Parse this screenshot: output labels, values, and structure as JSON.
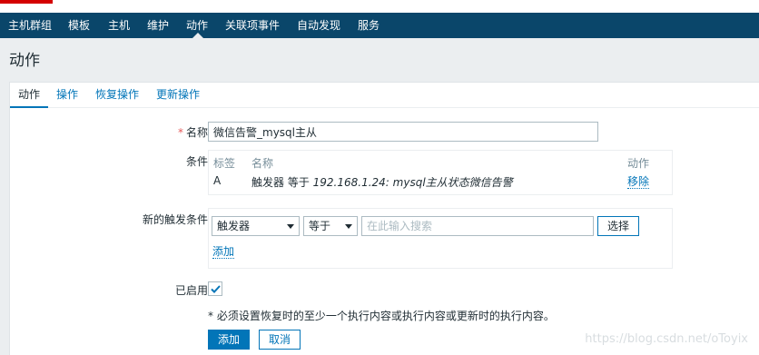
{
  "nav": {
    "items": [
      {
        "label": "主机群组"
      },
      {
        "label": "模板"
      },
      {
        "label": "主机"
      },
      {
        "label": "维护"
      },
      {
        "label": "动作"
      },
      {
        "label": "关联项事件"
      },
      {
        "label": "自动发现"
      },
      {
        "label": "服务"
      }
    ],
    "active": "动作"
  },
  "page": {
    "title": "动作"
  },
  "tabs": [
    {
      "label": "动作"
    },
    {
      "label": "操作"
    },
    {
      "label": "恢复操作"
    },
    {
      "label": "更新操作"
    }
  ],
  "form": {
    "name_label": "名称",
    "name_value": "微信告警_mysql主从",
    "conditions_label": "条件",
    "conditions_table": {
      "headers": {
        "tag": "标签",
        "name": "名称",
        "action": "动作"
      },
      "rows": [
        {
          "tag": "A",
          "name_prefix": "触发器 等于 ",
          "name_value": "192.168.1.24: mysql主从状态微信告警",
          "action": "移除"
        }
      ]
    },
    "new_condition_label": "新的触发条件",
    "new_condition": {
      "type_select": "触发器",
      "operator_select": "等于",
      "search_placeholder": "在此输入搜索",
      "select_button": "选择",
      "add_link": "添加"
    },
    "enabled_label": "已启用",
    "enabled": true,
    "note": "* 必须设置恢复时的至少一个执行内容或执行内容或更新时的执行内容。",
    "add_button": "添加",
    "cancel_button": "取消"
  },
  "watermark": "https://blog.csdn.net/oToyix"
}
